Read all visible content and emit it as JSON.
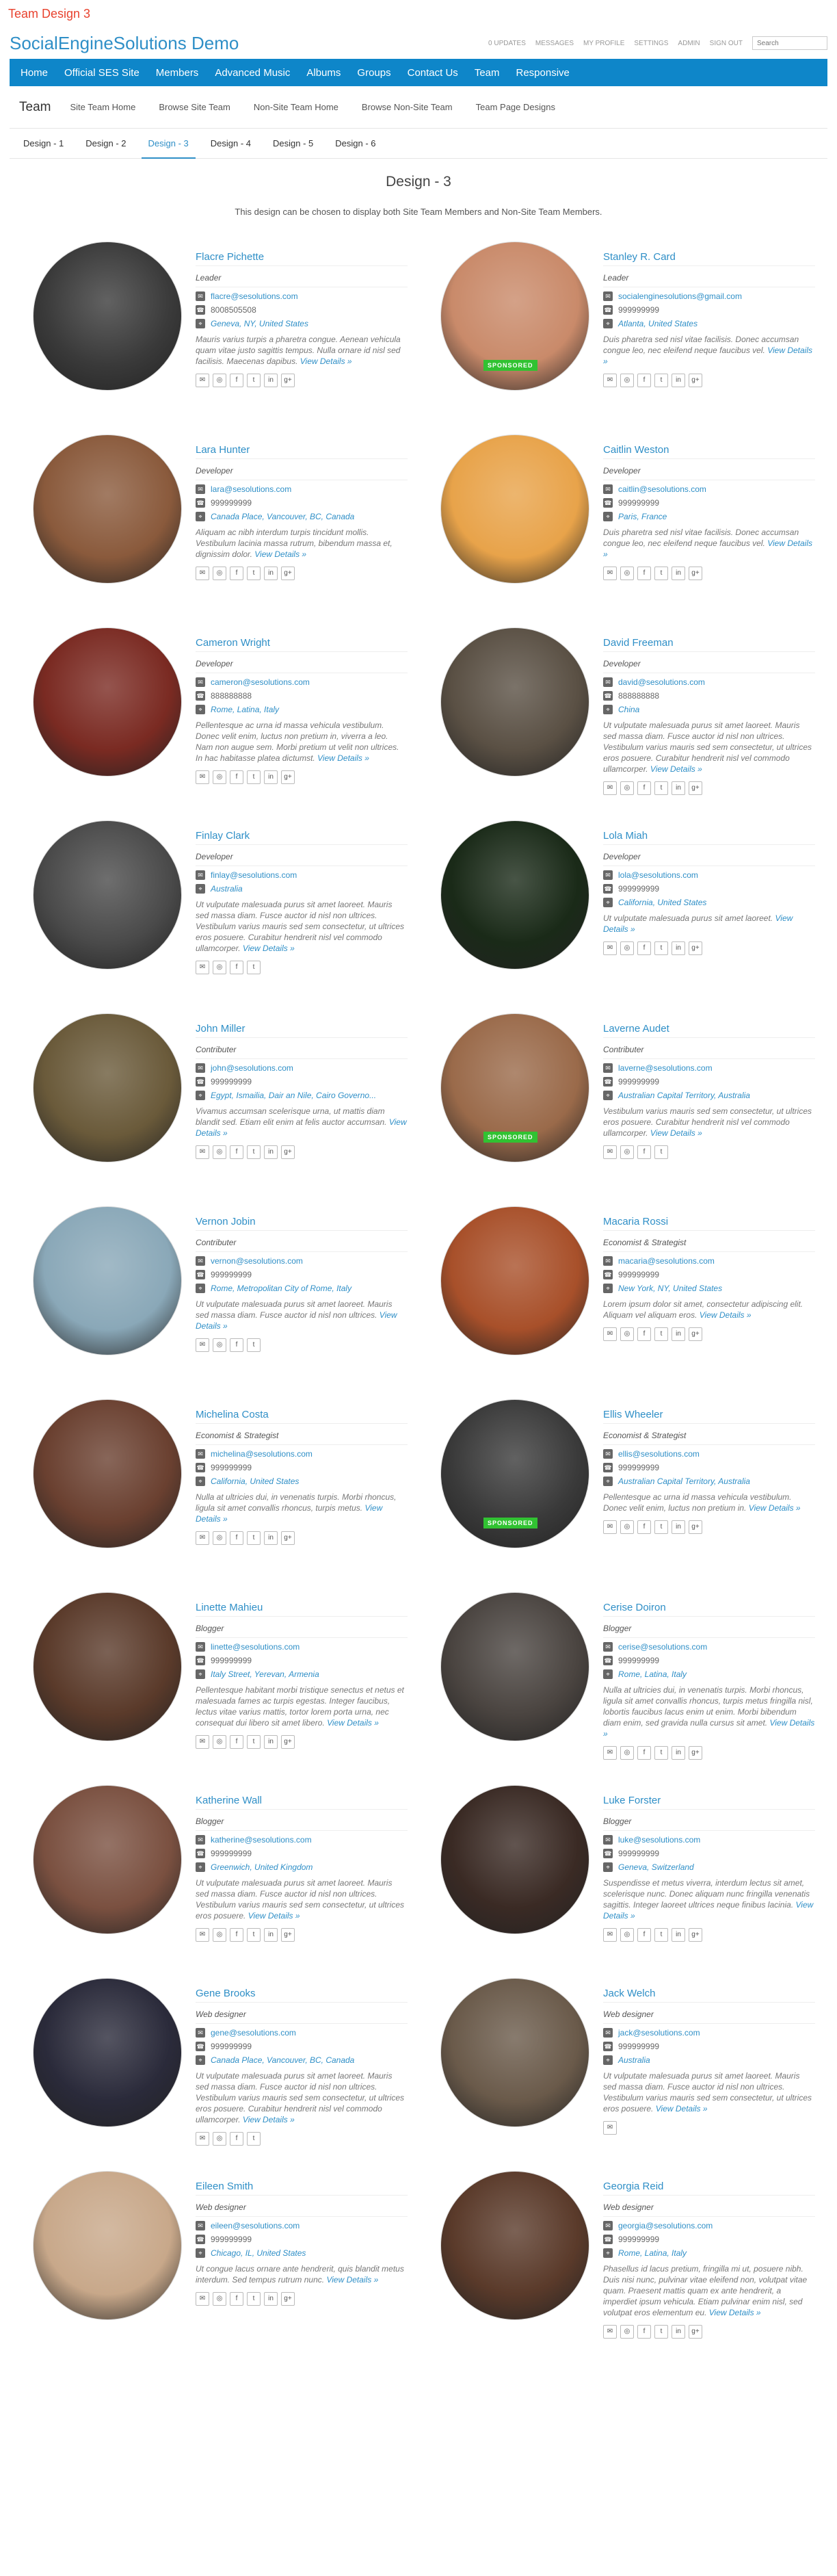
{
  "page_label": "Team Design 3",
  "site_title": "SocialEngineSolutions Demo",
  "mini_nav": [
    "0 UPDATES",
    "MESSAGES",
    "MY PROFILE",
    "SETTINGS",
    "ADMIN",
    "SIGN OUT"
  ],
  "search_placeholder": "Search",
  "main_nav": [
    "Home",
    "Official SES Site",
    "Members",
    "Advanced Music",
    "Albums",
    "Groups",
    "Contact Us",
    "Team",
    "Responsive"
  ],
  "sub_nav": {
    "title": "Team",
    "links": [
      "Site Team Home",
      "Browse Site Team",
      "Non-Site Team Home",
      "Browse Non-Site Team",
      "Team Page Designs"
    ]
  },
  "tabs": [
    "Design - 1",
    "Design - 2",
    "Design - 3",
    "Design - 4",
    "Design - 5",
    "Design - 6"
  ],
  "active_tab": 2,
  "design_title": "Design - 3",
  "design_desc": "This design can be chosen to display both Site Team Members and Non-Site Team Members.",
  "more_label": "View Details »",
  "sponsored_label": "SPONSORED",
  "members": [
    {
      "name": "Flacre Pichette",
      "designation": "Leader",
      "email": "flacre@sesolutions.com",
      "phone": "8008505508",
      "location": "Geneva, NY, United States",
      "bio": "Mauris varius turpis a pharetra congue. Aenean vehicula quam vitae justo sagittis tempus. Nulla ornare id nisl sed facilisis. Maecenas dapibus.",
      "socials": 6,
      "sponsored": false,
      "tone": "#3a3a3a"
    },
    {
      "name": "Stanley R. Card",
      "designation": "Leader",
      "email": "socialenginesolutions@gmail.com",
      "phone": "999999999",
      "location": "Atlanta, United States",
      "bio": "Duis pharetra sed nisl vitae facilisis. Donec accumsan congue leo, nec eleifend neque faucibus vel.",
      "socials": 6,
      "sponsored": true,
      "tone": "#c98a6a"
    },
    {
      "name": "Lara Hunter",
      "designation": "Developer",
      "email": "lara@sesolutions.com",
      "phone": "999999999",
      "location": "Canada Place, Vancouver, BC, Canada",
      "bio": "Aliquam ac nibh interdum turpis tincidunt mollis. Vestibulum lacinia massa rutrum, bibendum massa et, dignissim dolor.",
      "socials": 6,
      "sponsored": false,
      "tone": "#8a5a3c"
    },
    {
      "name": "Caitlin Weston",
      "designation": "Developer",
      "email": "caitlin@sesolutions.com",
      "phone": "999999999",
      "location": "Paris, France",
      "bio": "Duis pharetra sed nisl vitae facilisis. Donec accumsan congue leo, nec eleifend neque faucibus vel.",
      "socials": 6,
      "sponsored": false,
      "tone": "#e8a34a"
    },
    {
      "name": "Cameron Wright",
      "designation": "Developer",
      "email": "cameron@sesolutions.com",
      "phone": "888888888",
      "location": "Rome, Latina, Italy",
      "bio": "Pellentesque ac urna id massa vehicula vestibulum. Donec velit enim, luctus non pretium in, viverra a leo. Nam non augue sem. Morbi pretium ut velit non ultrices. In hac habitasse platea dictumst.",
      "socials": 6,
      "sponsored": false,
      "tone": "#7a2a22"
    },
    {
      "name": "David Freeman",
      "designation": "Developer",
      "email": "david@sesolutions.com",
      "phone": "888888888",
      "location": "China",
      "bio": "Ut vulputate malesuada purus sit amet laoreet. Mauris sed massa diam. Fusce auctor id nisl non ultrices. Vestibulum varius mauris sed sem consectetur, ut ultrices eros posuere. Curabitur hendrerit nisl vel commodo ullamcorper.",
      "socials": 6,
      "sponsored": false,
      "tone": "#5a5044"
    },
    {
      "name": "Finlay Clark",
      "designation": "Developer",
      "email": "finlay@sesolutions.com",
      "phone": "",
      "location": "Australia",
      "bio": "Ut vulputate malesuada purus sit amet laoreet. Mauris sed massa diam. Fusce auctor id nisl non ultrices. Vestibulum varius mauris sed sem consectetur, ut ultrices eros posuere. Curabitur hendrerit nisl vel commodo ullamcorper.",
      "socials": 4,
      "sponsored": false,
      "tone": "#4a4a4a"
    },
    {
      "name": "Lola Miah",
      "designation": "Developer",
      "email": "lola@sesolutions.com",
      "phone": "999999999",
      "location": "California, United States",
      "bio": "Ut vulputate malesuada purus sit amet laoreet.",
      "socials": 6,
      "sponsored": false,
      "tone": "#1a2a18"
    },
    {
      "name": "John Miller",
      "designation": "Contributer",
      "email": "john@sesolutions.com",
      "phone": "999999999",
      "location": "Egypt, Ismailia, Dair an Nile, Cairo Governo...",
      "bio": "Vivamus accumsan scelerisque urna, ut mattis diam blandit sed. Etiam elit enim at felis auctor accumsan.",
      "socials": 6,
      "sponsored": false,
      "tone": "#6a5a3a"
    },
    {
      "name": "Laverne Audet",
      "designation": "Contributer",
      "email": "laverne@sesolutions.com",
      "phone": "999999999",
      "location": "Australian Capital Territory, Australia",
      "bio": "Vestibulum varius mauris sed sem consectetur, ut ultrices eros posuere. Curabitur hendrerit nisl vel commodo ullamcorper.",
      "socials": 4,
      "sponsored": true,
      "tone": "#9a6a4a"
    },
    {
      "name": "Vernon Jobin",
      "designation": "Contributer",
      "email": "vernon@sesolutions.com",
      "phone": "999999999",
      "location": "Rome, Metropolitan City of Rome, Italy",
      "bio": "Ut vulputate malesuada purus sit amet laoreet. Mauris sed massa diam. Fusce auctor id nisl non ultrices.",
      "socials": 4,
      "sponsored": false,
      "tone": "#8aa8b8"
    },
    {
      "name": "Macaria Rossi",
      "designation": "Economist & Strategist",
      "email": "macaria@sesolutions.com",
      "phone": "999999999",
      "location": "New York, NY, United States",
      "bio": "Lorem ipsum dolor sit amet, consectetur adipiscing elit. Aliquam vel aliquam eros.",
      "socials": 6,
      "sponsored": false,
      "tone": "#a8502a"
    },
    {
      "name": "Michelina Costa",
      "designation": "Economist & Strategist",
      "email": "michelina@sesolutions.com",
      "phone": "999999999",
      "location": "California, United States",
      "bio": "Nulla at ultricies dui, in venenatis turpis. Morbi rhoncus, ligula sit amet convallis rhoncus, turpis metus.",
      "socials": 6,
      "sponsored": false,
      "tone": "#6a4030"
    },
    {
      "name": "Ellis Wheeler",
      "designation": "Economist & Strategist",
      "email": "ellis@sesolutions.com",
      "phone": "999999999",
      "location": "Australian Capital Territory, Australia",
      "bio": "Pellentesque ac urna id massa vehicula vestibulum. Donec velit enim, luctus non pretium in.",
      "socials": 6,
      "sponsored": true,
      "tone": "#3a3a3a"
    },
    {
      "name": "Linette Mahieu",
      "designation": "Blogger",
      "email": "linette@sesolutions.com",
      "phone": "999999999",
      "location": "Italy Street, Yerevan, Armenia",
      "bio": "Pellentesque habitant morbi tristique senectus et netus et malesuada fames ac turpis egestas. Integer faucibus, lectus vitae varius mattis, tortor lorem porta urna, nec consequat dui libero sit amet libero.",
      "socials": 6,
      "sponsored": false,
      "tone": "#5a3a2a"
    },
    {
      "name": "Cerise Doiron",
      "designation": "Blogger",
      "email": "cerise@sesolutions.com",
      "phone": "999999999",
      "location": "Rome, Latina, Italy",
      "bio": "Nulla at ultricies dui, in venenatis turpis. Morbi rhoncus, ligula sit amet convallis rhoncus, turpis metus fringilla nisl, lobortis faucibus lacus enim ut enim. Morbi bibendum diam enim, sed gravida nulla cursus sit amet.",
      "socials": 6,
      "sponsored": false,
      "tone": "#4a4440"
    },
    {
      "name": "Katherine Wall",
      "designation": "Blogger",
      "email": "katherine@sesolutions.com",
      "phone": "999999999",
      "location": "Greenwich, United Kingdom",
      "bio": "Ut vulputate malesuada purus sit amet laoreet. Mauris sed massa diam. Fusce auctor id nisl non ultrices. Vestibulum varius mauris sed sem consectetur, ut ultrices eros posuere.",
      "socials": 6,
      "sponsored": false,
      "tone": "#7a5040"
    },
    {
      "name": "Luke Forster",
      "designation": "Blogger",
      "email": "luke@sesolutions.com",
      "phone": "999999999",
      "location": "Geneva, Switzerland",
      "bio": "Suspendisse et metus viverra, interdum lectus sit amet, scelerisque nunc. Donec aliquam nunc fringilla venenatis sagittis. Integer laoreet ultrices neque finibus lacinia.",
      "socials": 6,
      "sponsored": false,
      "tone": "#3a2a24"
    },
    {
      "name": "Gene Brooks",
      "designation": "Web designer",
      "email": "gene@sesolutions.com",
      "phone": "999999999",
      "location": "Canada Place, Vancouver, BC, Canada",
      "bio": "Ut vulputate malesuada purus sit amet laoreet. Mauris sed massa diam. Fusce auctor id nisl non ultrices. Vestibulum varius mauris sed sem consectetur, ut ultrices eros posuere. Curabitur hendrerit nisl vel commodo ullamcorper.",
      "socials": 4,
      "sponsored": false,
      "tone": "#2a2a3a"
    },
    {
      "name": "Jack Welch",
      "designation": "Web designer",
      "email": "jack@sesolutions.com",
      "phone": "999999999",
      "location": "Australia",
      "bio": "Ut vulputate malesuada purus sit amet laoreet. Mauris sed massa diam. Fusce auctor id nisl non ultrices. Vestibulum varius mauris sed sem consectetur, ut ultrices eros posuere.",
      "socials": 1,
      "sponsored": false,
      "tone": "#6a5a4a"
    },
    {
      "name": "Eileen Smith",
      "designation": "Web designer",
      "email": "eileen@sesolutions.com",
      "phone": "999999999",
      "location": "Chicago, IL, United States",
      "bio": "Ut congue lacus ornare ante hendrerit, quis blandit metus interdum. Sed tempus rutrum nunc.",
      "socials": 6,
      "sponsored": false,
      "tone": "#c8a88a"
    },
    {
      "name": "Georgia Reid",
      "designation": "Web designer",
      "email": "georgia@sesolutions.com",
      "phone": "999999999",
      "location": "Rome, Latina, Italy",
      "bio": "Phasellus id lacus pretium, fringilla mi ut, posuere nibh. Duis nisi nunc, pulvinar vitae eleifend non, volutpat vitae quam. Praesent mattis quam ex ante hendrerit, a imperdiet ipsum vehicula. Etiam pulvinar enim nisl, sed volutpat eros elementum eu.",
      "socials": 6,
      "sponsored": false,
      "tone": "#5a3a2a"
    }
  ],
  "social_icons": [
    "mail-icon",
    "globe-icon",
    "facebook-icon",
    "twitter-icon",
    "linkedin-icon",
    "google-plus-icon"
  ],
  "social_glyphs": [
    "✉",
    "◎",
    "f",
    "t",
    "in",
    "g+"
  ],
  "colors": {
    "accent": "#2f8fc7",
    "nav": "#0e86c9",
    "sponsored": "#31c232",
    "page_label": "#e8422e"
  }
}
